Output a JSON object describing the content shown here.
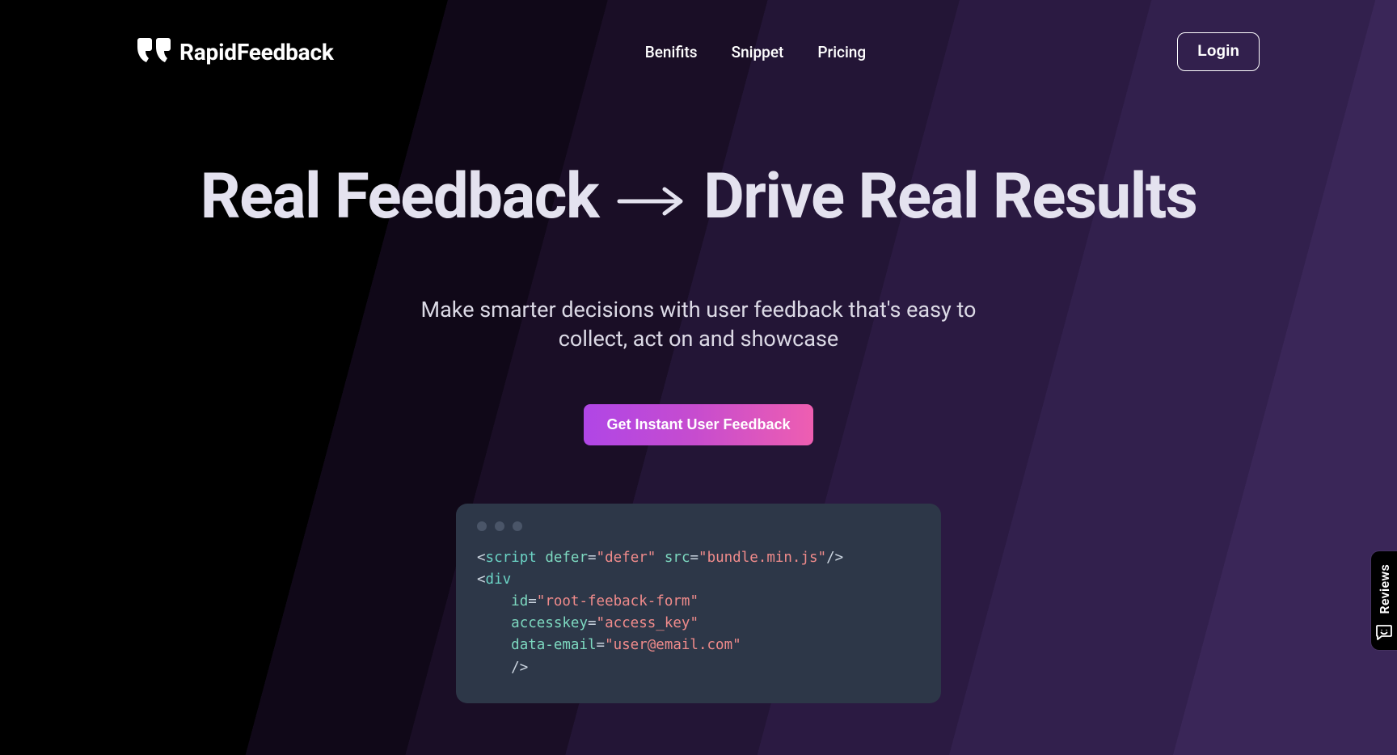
{
  "brand": {
    "name": "RapidFeedback"
  },
  "nav": {
    "items": [
      {
        "label": "Benifits"
      },
      {
        "label": "Snippet"
      },
      {
        "label": "Pricing"
      }
    ]
  },
  "auth": {
    "login_label": "Login"
  },
  "hero": {
    "headline_left": "Real Feedback",
    "headline_right": "Drive Real Results",
    "subhead": "Make smarter decisions with user feedback that's easy to\ncollect, act on and showcase",
    "cta_label": "Get Instant User Feedback"
  },
  "snippet": {
    "line1": {
      "tag": "script",
      "attr1": "defer",
      "val1": "defer",
      "attr2": "src",
      "val2": "bundle.min.js"
    },
    "line2": {
      "tag": "div"
    },
    "line3": {
      "attr": "id",
      "val": "root-feeback-form"
    },
    "line4": {
      "attr": "accesskey",
      "val": "access_key"
    },
    "line5": {
      "attr": "data-email",
      "val": "user@email.com"
    }
  },
  "reviews_widget": {
    "label": "Reviews"
  }
}
